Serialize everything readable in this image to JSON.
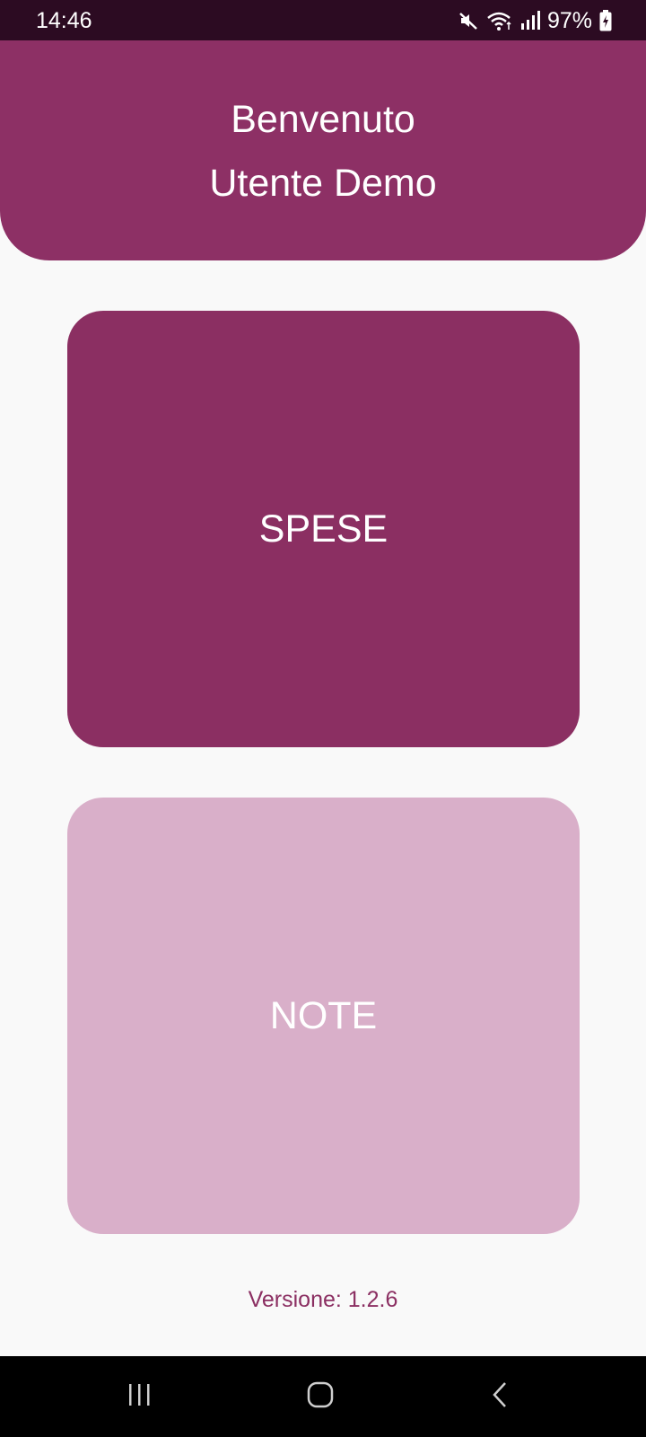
{
  "status_bar": {
    "time": "14:46",
    "battery": "97%",
    "icons": [
      "mute-icon",
      "wifi-icon",
      "signal-icon",
      "battery-charging-icon"
    ]
  },
  "header": {
    "greeting": "Benvenuto",
    "user_name": "Utente Demo"
  },
  "menu": {
    "spese_label": "SPESE",
    "note_label": "NOTE"
  },
  "footer": {
    "version": "Versione: 1.2.6"
  },
  "nav_bar": {
    "icons": [
      "recents-icon",
      "home-icon",
      "back-icon"
    ]
  },
  "colors": {
    "status_bar": "#2c0b22",
    "primary": "#8b2f62",
    "secondary": "#d9afc9",
    "background": "#f9f9f9"
  }
}
